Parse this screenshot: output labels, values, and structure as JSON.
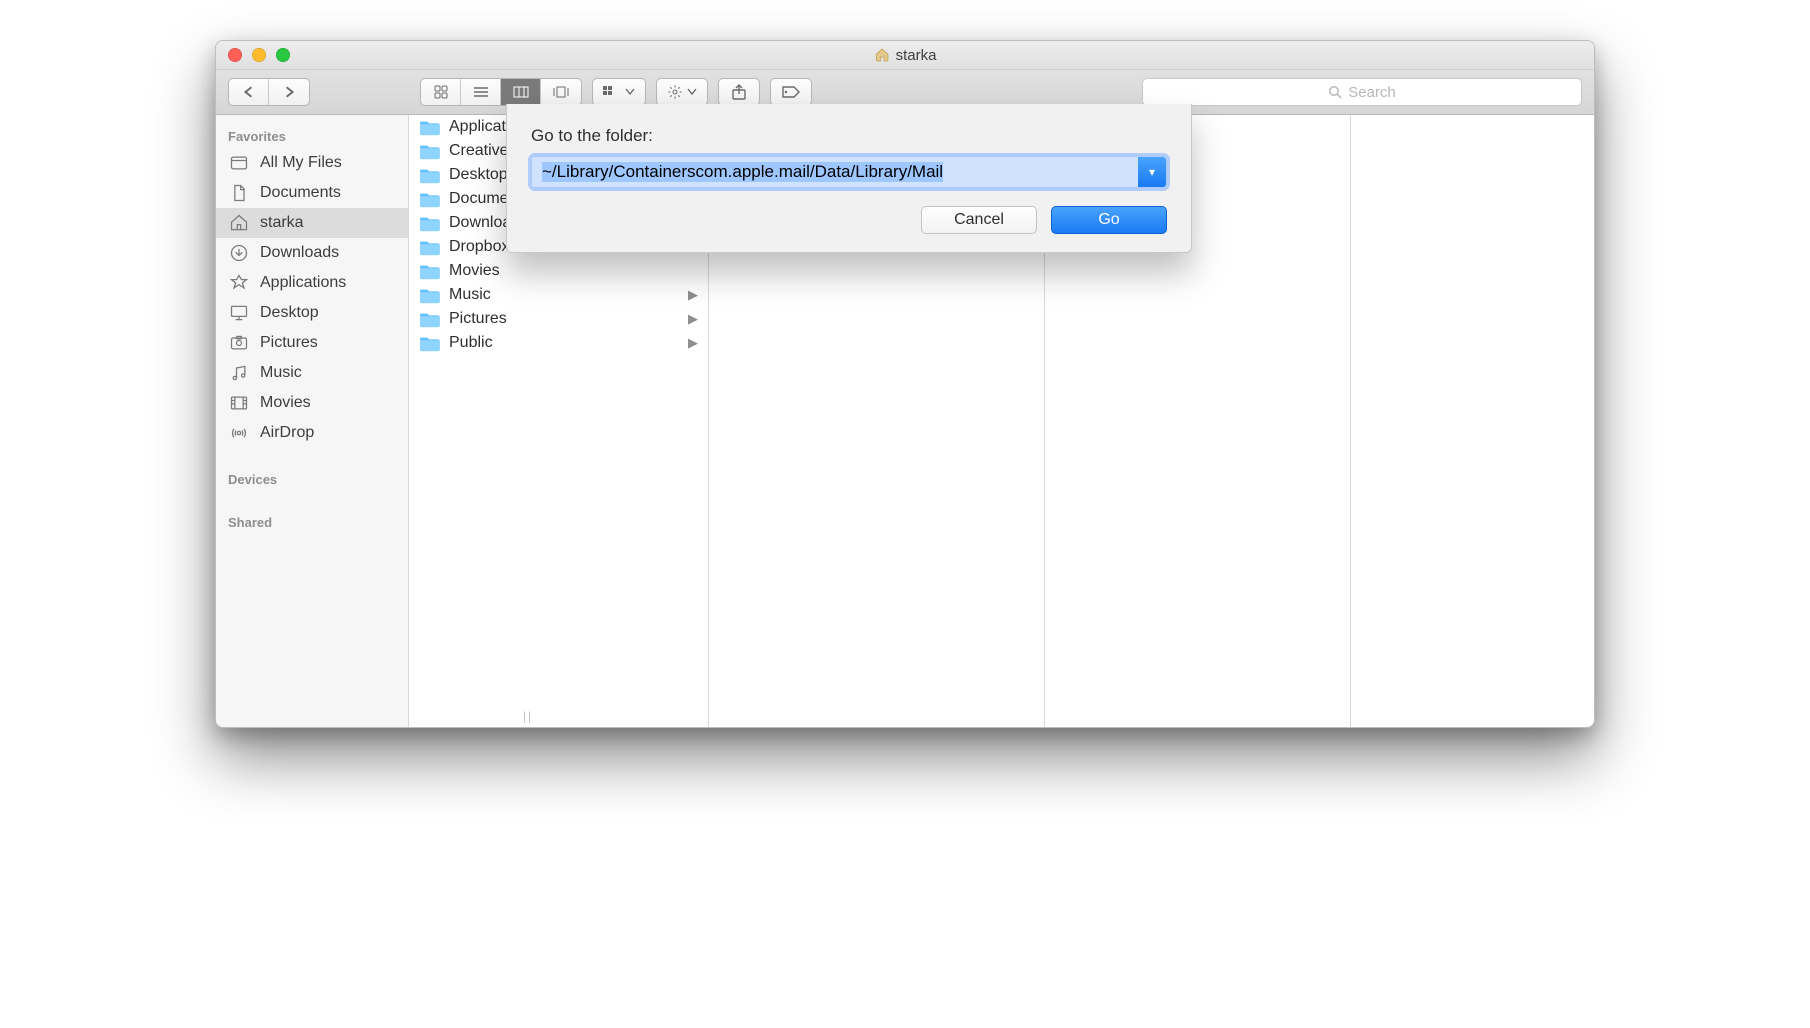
{
  "window": {
    "title": "starka"
  },
  "toolbar": {
    "search_placeholder": "Search"
  },
  "sidebar": {
    "sections": [
      {
        "header": "Favorites",
        "items": [
          {
            "label": "All My Files",
            "icon": "allfiles"
          },
          {
            "label": "Documents",
            "icon": "documents"
          },
          {
            "label": "starka",
            "icon": "home",
            "selected": true
          },
          {
            "label": "Downloads",
            "icon": "downloads"
          },
          {
            "label": "Applications",
            "icon": "applications"
          },
          {
            "label": "Desktop",
            "icon": "desktop"
          },
          {
            "label": "Pictures",
            "icon": "pictures"
          },
          {
            "label": "Music",
            "icon": "music"
          },
          {
            "label": "Movies",
            "icon": "movies"
          },
          {
            "label": "AirDrop",
            "icon": "airdrop"
          }
        ]
      },
      {
        "header": "Devices",
        "items": []
      },
      {
        "header": "Shared",
        "items": []
      }
    ]
  },
  "column1": {
    "items": [
      {
        "label": "Applications"
      },
      {
        "label": "Creative Cloud Files"
      },
      {
        "label": "Desktop"
      },
      {
        "label": "Documents"
      },
      {
        "label": "Downloads"
      },
      {
        "label": "Dropbox"
      },
      {
        "label": "Movies"
      },
      {
        "label": "Music",
        "hasChildren": true
      },
      {
        "label": "Pictures",
        "hasChildren": true
      },
      {
        "label": "Public",
        "hasChildren": true
      }
    ]
  },
  "dialog": {
    "label": "Go to the folder:",
    "path": "~/Library/Containerscom.apple.mail/Data/Library/Mail",
    "cancel": "Cancel",
    "go": "Go"
  }
}
